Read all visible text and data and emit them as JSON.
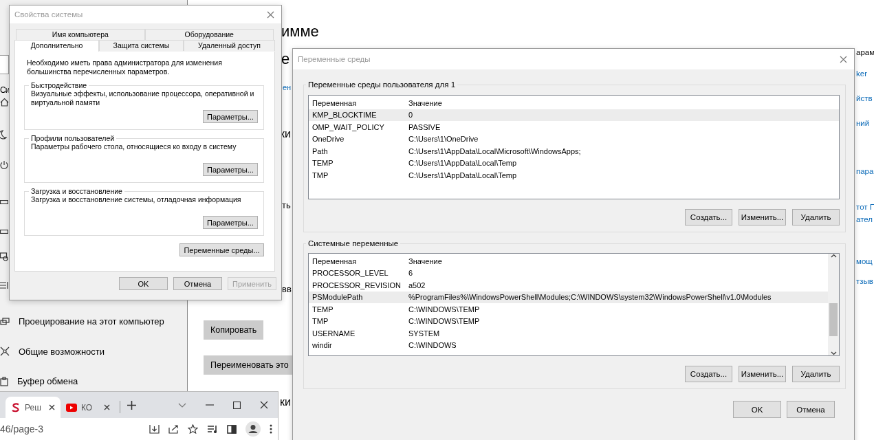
{
  "settings_app": {
    "sidebar_fragment": "Си",
    "sidebar_items": [
      {
        "label": "Проецирование на этот компьютер"
      },
      {
        "label": "Общие возможности"
      },
      {
        "label": "Буфер обмена"
      }
    ],
    "content_fragments": [
      {
        "kind": "heading",
        "text": "имме"
      },
      {
        "kind": "heading",
        "text": "е"
      },
      {
        "kind": "link",
        "text": "ен"
      },
      {
        "kind": "heading",
        "text": "ки"
      },
      {
        "kind": "plain",
        "text": "ть"
      },
      {
        "kind": "plain",
        "text": "вв"
      },
      {
        "kind": "heading",
        "text": "ки"
      }
    ],
    "buttons": [
      "Копировать",
      "Переименовать это"
    ],
    "right_fragments": [
      {
        "kind": "plain",
        "text": "арам"
      },
      {
        "kind": "link",
        "text": "ker"
      },
      {
        "kind": "link",
        "text": "йств"
      },
      {
        "kind": "link",
        "text": "ний"
      },
      {
        "kind": "link",
        "text": "пара"
      },
      {
        "kind": "link",
        "text": "тот П"
      },
      {
        "kind": "link",
        "text": "ател"
      },
      {
        "kind": "link",
        "text": "мощ"
      },
      {
        "kind": "link",
        "text": "тзыв"
      }
    ]
  },
  "system_properties": {
    "title": "Свойства системы",
    "tab_rows": [
      {
        "tabs": [
          {
            "label": "Имя компьютера",
            "selected": false
          },
          {
            "label": "Оборудование",
            "selected": false
          }
        ]
      },
      {
        "tabs": [
          {
            "label": "Дополнительно",
            "selected": true
          },
          {
            "label": "Защита системы",
            "selected": false
          },
          {
            "label": "Удаленный доступ",
            "selected": false
          }
        ]
      }
    ],
    "notice": "Необходимо иметь права администратора для изменения большинства перечисленных параметров.",
    "groups": [
      {
        "title": "Быстродействие",
        "description": "Визуальные эффекты, использование процессора, оперативной и виртуальной памяти",
        "button": "Параметры..."
      },
      {
        "title": "Профили пользователей",
        "description": "Параметры рабочего стола, относящиеся ко входу в систему",
        "button": "Параметры..."
      },
      {
        "title": "Загрузка и восстановление",
        "description": "Загрузка и восстановление системы, отладочная информация",
        "button": "Параметры..."
      }
    ],
    "env_button": "Переменные среды...",
    "buttons": [
      {
        "label": "OK",
        "disabled": false
      },
      {
        "label": "Отмена",
        "disabled": false
      },
      {
        "label": "Применить",
        "disabled": true
      }
    ]
  },
  "environment_variables": {
    "title": "Переменные среды",
    "sections": [
      {
        "title": "Переменные среды пользователя для 1",
        "columns": [
          "Переменная",
          "Значение"
        ],
        "scrollable": false,
        "rows": [
          {
            "name": "KMP_BLOCKTIME",
            "value": "0",
            "selected": true
          },
          {
            "name": "OMP_WAIT_POLICY",
            "value": "PASSIVE",
            "selected": false
          },
          {
            "name": "OneDrive",
            "value": "C:\\Users\\1\\OneDrive",
            "selected": false
          },
          {
            "name": "Path",
            "value": "C:\\Users\\1\\AppData\\Local\\Microsoft\\WindowsApps;",
            "selected": false
          },
          {
            "name": "TEMP",
            "value": "C:\\Users\\1\\AppData\\Local\\Temp",
            "selected": false
          },
          {
            "name": "TMP",
            "value": "C:\\Users\\1\\AppData\\Local\\Temp",
            "selected": false
          }
        ],
        "buttons": [
          "Создать...",
          "Изменить...",
          "Удалить"
        ]
      },
      {
        "title": "Системные переменные",
        "columns": [
          "Переменная",
          "Значение"
        ],
        "scrollable": true,
        "rows": [
          {
            "name": "PROCESSOR_LEVEL",
            "value": "6",
            "selected": false
          },
          {
            "name": "PROCESSOR_REVISION",
            "value": "a502",
            "selected": false
          },
          {
            "name": "PSModulePath",
            "value": "%ProgramFiles%\\WindowsPowerShell\\Modules;C:\\WINDOWS\\system32\\WindowsPowerShell\\v1.0\\Modules",
            "selected": true
          },
          {
            "name": "TEMP",
            "value": "C:\\WINDOWS\\TEMP",
            "selected": false
          },
          {
            "name": "TMP",
            "value": "C:\\WINDOWS\\TEMP",
            "selected": false
          },
          {
            "name": "USERNAME",
            "value": "SYSTEM",
            "selected": false
          },
          {
            "name": "windir",
            "value": "C:\\WINDOWS",
            "selected": false
          }
        ],
        "buttons": [
          "Создать...",
          "Изменить...",
          "Удалить"
        ]
      }
    ],
    "buttons": [
      "OK",
      "Отмена"
    ]
  },
  "browser": {
    "tabs": [
      {
        "title": "Реш",
        "selected": true
      },
      {
        "title": "КО",
        "selected": false
      }
    ],
    "address": "46/page-3"
  }
}
